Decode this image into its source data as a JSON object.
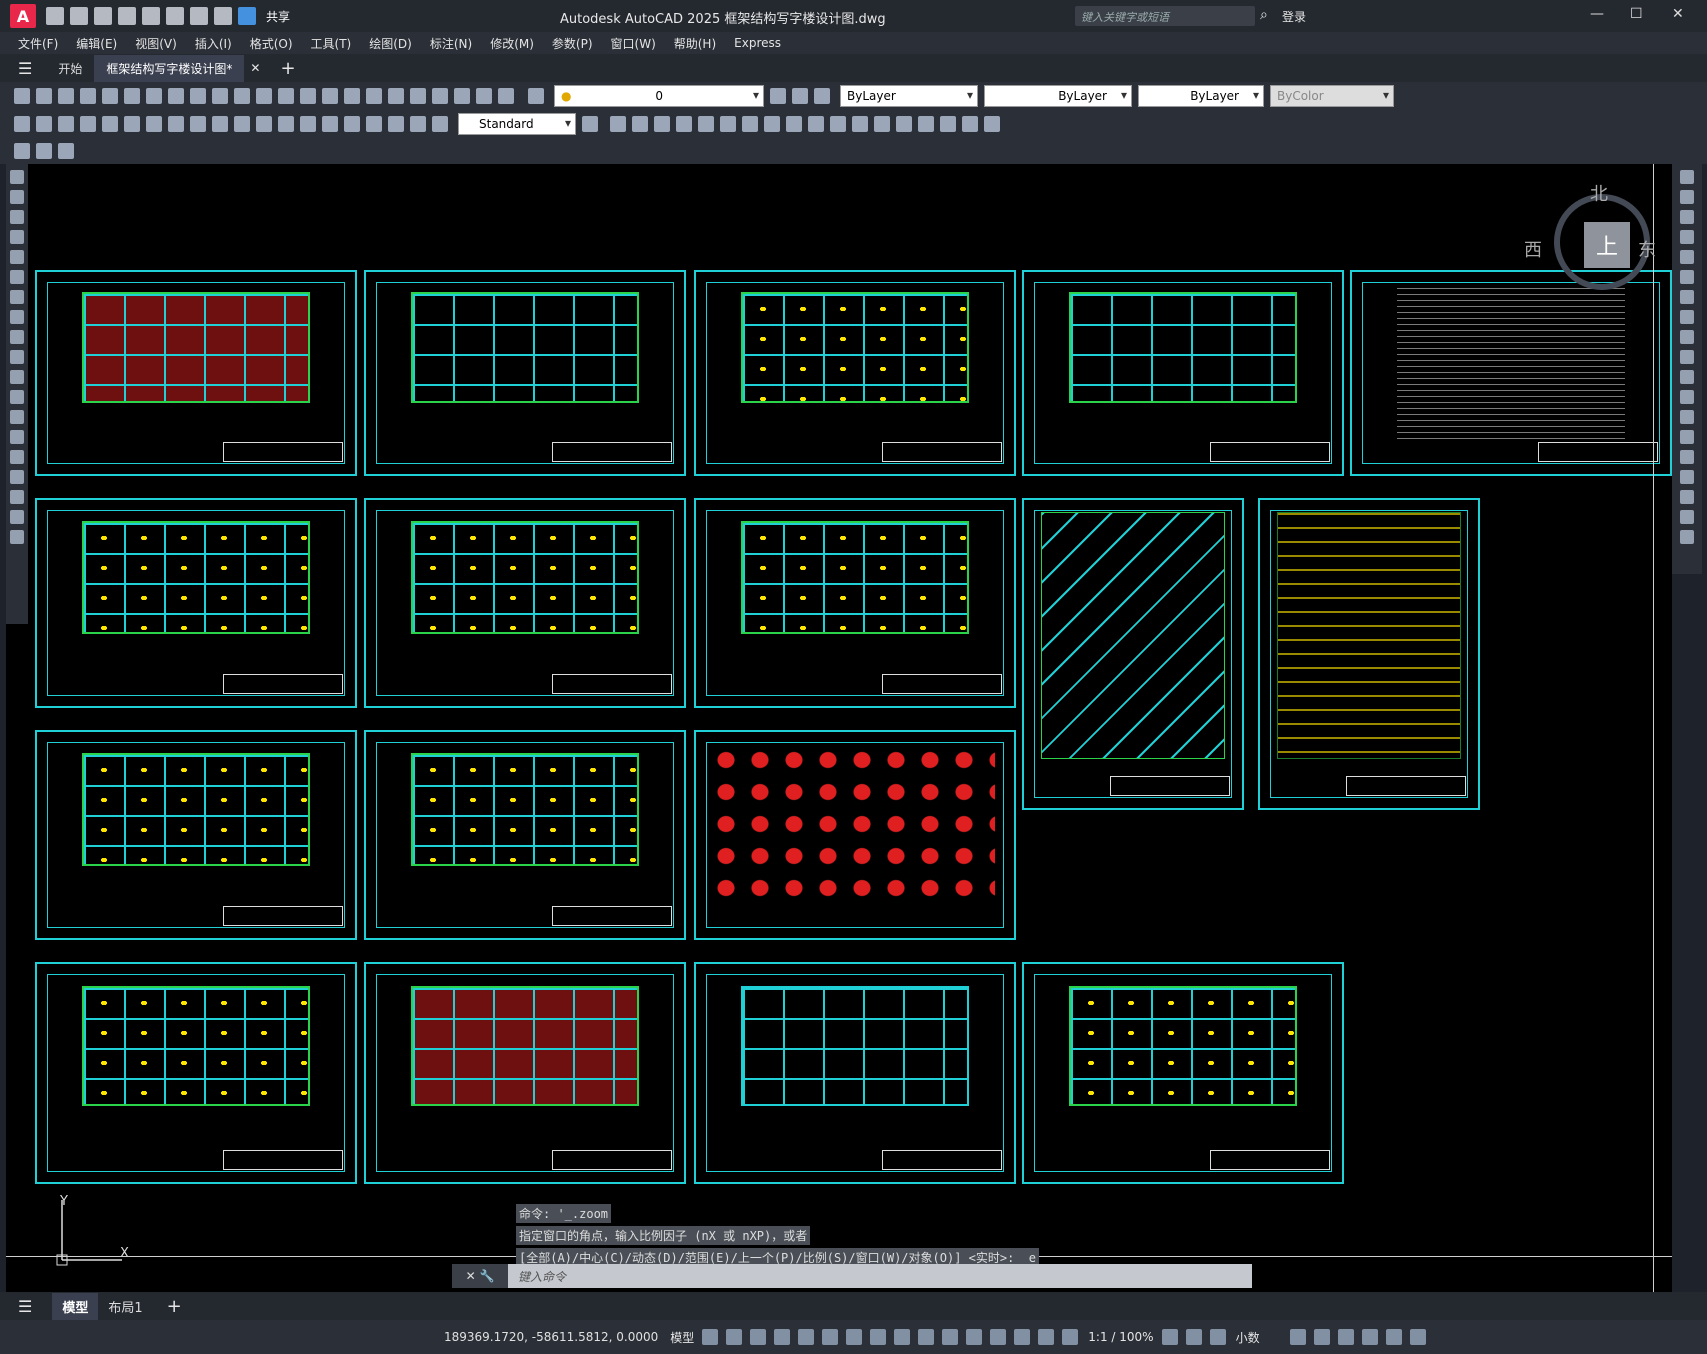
{
  "window": {
    "title": "Autodesk AutoCAD 2025    框架结构写字楼设计图.dwg",
    "search_placeholder": "键入关键字或短语",
    "login": "登录",
    "share": "共享",
    "app_letter": "A"
  },
  "menu": [
    "文件(F)",
    "编辑(E)",
    "视图(V)",
    "插入(I)",
    "格式(O)",
    "工具(T)",
    "绘图(D)",
    "标注(N)",
    "修改(M)",
    "参数(P)",
    "窗口(W)",
    "帮助(H)",
    "Express"
  ],
  "tabs": [
    {
      "label": "开始",
      "active": false
    },
    {
      "label": "框架结构写字楼设计图*",
      "active": true
    }
  ],
  "properties": {
    "layer": "0",
    "color": "ByLayer",
    "linetype": "ByLayer",
    "lineweight": "ByLayer",
    "plotstyle": "ByColor",
    "textstyle": "Standard"
  },
  "viewcube": {
    "north": "北",
    "west": "西",
    "east": "东",
    "face": "上"
  },
  "command": {
    "history": [
      "命令: '_.zoom",
      "指定窗口的角点，输入比例因子 (nX 或 nXP)，或者",
      "[全部(A)/中心(C)/动态(D)/范围(E)/上一个(P)/比例(S)/窗口(W)/对象(O)] <实时>: _e"
    ],
    "placeholder": "键入命令"
  },
  "ucs": {
    "y": "Y",
    "x": "X"
  },
  "layouts": [
    {
      "label": "模型",
      "active": true
    },
    {
      "label": "布局1",
      "active": false
    }
  ],
  "status": {
    "coords": "189369.1720, -58611.5812, 0.0000",
    "space": "模型",
    "scale": "1:1 / 100%",
    "units": "小数"
  },
  "colors": {
    "sheet_border": "#1fd0d6",
    "grid": "#2bd34a",
    "accent_red": "#e8274b"
  }
}
